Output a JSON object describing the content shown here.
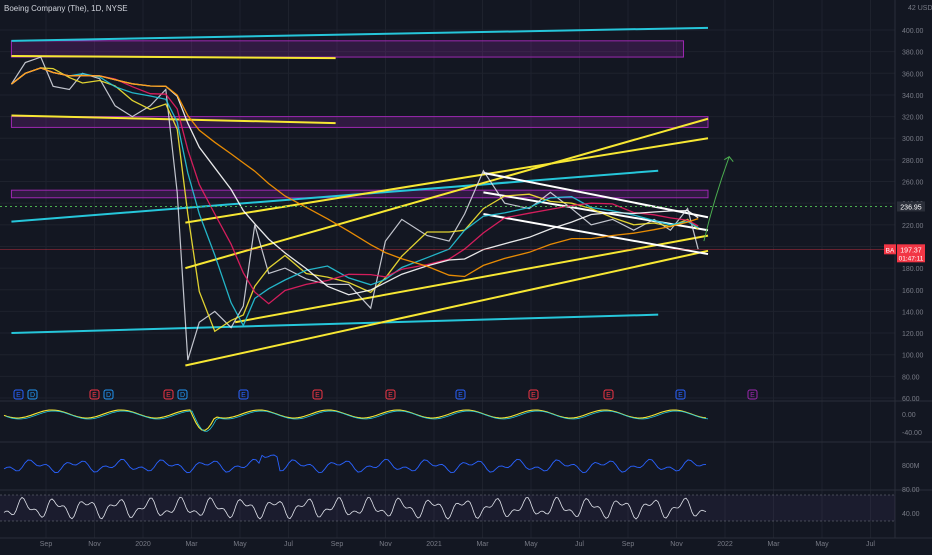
{
  "symbol_title": "Boeing Company (The), 1D, NYSE",
  "currency_label": "42 USD",
  "colors": {
    "background": "#131722",
    "grid": "#1e222d",
    "axis_text": "#787b86",
    "price": "#e0e3eb",
    "cyan_line": "#26c6da",
    "yellow_line": "#f7e733",
    "white_line": "#ffffff",
    "orange_line": "#ff9800",
    "pink_line": "#e91e63",
    "purple_zone": "#9c27b0",
    "green_arrow": "#4caf50",
    "current_price": "#f23645",
    "marker_price": "#2a2e39"
  },
  "price_axis": {
    "ticks": [
      "400.00",
      "380.00",
      "360.00",
      "340.00",
      "320.00",
      "300.00",
      "280.00",
      "260.00",
      "240.00",
      "220.00",
      "200.00",
      "180.00",
      "160.00",
      "140.00",
      "120.00",
      "100.00",
      "80.00",
      "60.00"
    ],
    "marker_price_label": "236.95",
    "ba_label": "BA",
    "current_price_label": "197.37",
    "countdown_label": "01:47:11"
  },
  "pane_axis": {
    "oscillator_ticks": [
      "0.00",
      "-40.00"
    ],
    "volume_tick": "800M",
    "rsi_ticks": [
      "80.00",
      "40.00"
    ]
  },
  "time_axis": [
    "Sep",
    "Nov",
    "2020",
    "Mar",
    "May",
    "Jul",
    "Sep",
    "Nov",
    "2021",
    "Mar",
    "May",
    "Jul",
    "Sep",
    "Nov",
    "2022",
    "Mar",
    "May",
    "Jul"
  ],
  "events": [
    "E",
    "D",
    "E",
    "D",
    "E",
    "D",
    "E",
    "E",
    "E",
    "E",
    "E",
    "E",
    "E",
    "E"
  ],
  "chart_data": {
    "type": "line",
    "title": "Boeing Company (The), 1D, NYSE",
    "x_range": [
      "2019-08",
      "2022-08"
    ],
    "ylim": [
      60,
      420
    ],
    "price_series": [
      [
        "2019-08-15",
        350
      ],
      [
        "2019-09-01",
        370
      ],
      [
        "2019-09-20",
        375
      ],
      [
        "2019-10-05",
        348
      ],
      [
        "2019-10-25",
        345
      ],
      [
        "2019-11-10",
        360
      ],
      [
        "2019-12-01",
        355
      ],
      [
        "2019-12-20",
        330
      ],
      [
        "2020-01-10",
        320
      ],
      [
        "2020-02-01",
        330
      ],
      [
        "2020-02-20",
        345
      ],
      [
        "2020-03-05",
        250
      ],
      [
        "2020-03-18",
        95
      ],
      [
        "2020-04-01",
        130
      ],
      [
        "2020-04-20",
        140
      ],
      [
        "2020-05-10",
        125
      ],
      [
        "2020-05-25",
        145
      ],
      [
        "2020-06-08",
        220
      ],
      [
        "2020-06-25",
        175
      ],
      [
        "2020-07-15",
        180
      ],
      [
        "2020-08-10",
        170
      ],
      [
        "2020-09-05",
        165
      ],
      [
        "2020-10-01",
        165
      ],
      [
        "2020-10-28",
        143
      ],
      [
        "2020-11-15",
        205
      ],
      [
        "2020-12-05",
        225
      ],
      [
        "2021-01-05",
        210
      ],
      [
        "2021-02-01",
        205
      ],
      [
        "2021-02-20",
        230
      ],
      [
        "2021-03-15",
        270
      ],
      [
        "2021-04-10",
        240
      ],
      [
        "2021-05-10",
        235
      ],
      [
        "2021-06-05",
        250
      ],
      [
        "2021-07-01",
        235
      ],
      [
        "2021-07-25",
        220
      ],
      [
        "2021-08-20",
        225
      ],
      [
        "2021-09-15",
        215
      ],
      [
        "2021-10-10",
        225
      ],
      [
        "2021-10-30",
        215
      ],
      [
        "2021-11-20",
        235
      ],
      [
        "2021-12-03",
        197.37
      ]
    ],
    "current_price": 197.37,
    "marked_price": 236.95,
    "horizontal_zones": [
      {
        "from": 375,
        "to": 390,
        "start": "2019-08",
        "end": "2021-11"
      },
      {
        "from": 310,
        "to": 320,
        "start": "2019-08",
        "end": "2021-12"
      },
      {
        "from": 245,
        "to": 252,
        "start": "2019-08",
        "end": "2021-12"
      }
    ],
    "trendlines": [
      {
        "color": "cyan",
        "p1": [
          "2019-08",
          390
        ],
        "p2": [
          "2021-12",
          402
        ]
      },
      {
        "color": "cyan",
        "p1": [
          "2019-08",
          223
        ],
        "p2": [
          "2021-10",
          270
        ]
      },
      {
        "color": "cyan",
        "p1": [
          "2019-08",
          120
        ],
        "p2": [
          "2021-10",
          137
        ]
      },
      {
        "color": "yellow",
        "p1": [
          "2019-08",
          376
        ],
        "p2": [
          "2020-09",
          374
        ]
      },
      {
        "color": "yellow",
        "p1": [
          "2019-08",
          321
        ],
        "p2": [
          "2020-09",
          314
        ]
      },
      {
        "color": "yellow",
        "p1": [
          "2020-03",
          90
        ],
        "p2": [
          "2021-12",
          196
        ]
      },
      {
        "color": "yellow",
        "p1": [
          "2020-03",
          180
        ],
        "p2": [
          "2021-12",
          318
        ]
      },
      {
        "color": "yellow",
        "p1": [
          "2020-03",
          222
        ],
        "p2": [
          "2021-12",
          300
        ]
      },
      {
        "color": "yellow",
        "p1": [
          "2020-05",
          130
        ],
        "p2": [
          "2021-12",
          210
        ]
      },
      {
        "color": "white",
        "p1": [
          "2021-03",
          268
        ],
        "p2": [
          "2021-12",
          227
        ]
      },
      {
        "color": "white",
        "p1": [
          "2021-03",
          250
        ],
        "p2": [
          "2021-12",
          215
        ]
      },
      {
        "color": "white",
        "p1": [
          "2021-03",
          230
        ],
        "p2": [
          "2021-12",
          193
        ]
      }
    ]
  }
}
